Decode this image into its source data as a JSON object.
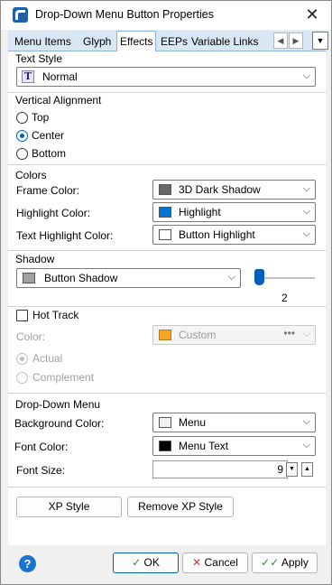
{
  "window": {
    "title": "Drop-Down Menu Button Properties",
    "close_glyph": "✕"
  },
  "tabs": [
    {
      "label": "Menu Items"
    },
    {
      "label": "Glyph"
    },
    {
      "label": "Effects",
      "active": true
    },
    {
      "label": "EEPs"
    },
    {
      "label": "Variable Links"
    }
  ],
  "text_style": {
    "group_label": "Text Style",
    "value": "Normal",
    "icon": "text-style-T-icon"
  },
  "vertical_alignment": {
    "group_label": "Vertical Alignment",
    "options": [
      {
        "label": "Top",
        "checked": false
      },
      {
        "label": "Center",
        "checked": true
      },
      {
        "label": "Bottom",
        "checked": false
      }
    ]
  },
  "colors": {
    "group_label": "Colors",
    "frame": {
      "label": "Frame Color:",
      "value": "3D Dark Shadow",
      "swatch": "#696969"
    },
    "highlight": {
      "label": "Highlight Color:",
      "value": "Highlight",
      "swatch": "#0078d7"
    },
    "text_highlight": {
      "label": "Text Highlight Color:",
      "value": "Button Highlight",
      "swatch": "#ffffff"
    }
  },
  "shadow": {
    "group_label": "Shadow",
    "value": "Button Shadow",
    "swatch": "#a0a0a0",
    "slider_value": "2"
  },
  "hot_track": {
    "checkbox_label": "Hot Track",
    "checked": false,
    "color_label": "Color:",
    "color_value": "Custom",
    "color_swatch": "#f5a623",
    "dots": "•••",
    "options": [
      {
        "label": "Actual",
        "checked": true
      },
      {
        "label": "Complement",
        "checked": false
      }
    ]
  },
  "dropdown_menu": {
    "group_label": "Drop-Down Menu",
    "background": {
      "label": "Background Color:",
      "value": "Menu",
      "swatch": "#f0f0f0"
    },
    "font_color": {
      "label": "Font Color:",
      "value": "Menu Text",
      "swatch": "#000000"
    },
    "font_size": {
      "label": "Font Size:",
      "value": "9"
    }
  },
  "style_buttons": {
    "xp": "XP Style",
    "remove_xp": "Remove XP Style"
  },
  "footer": {
    "help": "?",
    "ok": "OK",
    "cancel": "Cancel",
    "apply": "Apply"
  },
  "colors_theme": {
    "accent": "#005fb8",
    "tab_bg": "#d9e6f3",
    "ok_check": "#2e8b2e",
    "cancel_x": "#d13438"
  }
}
